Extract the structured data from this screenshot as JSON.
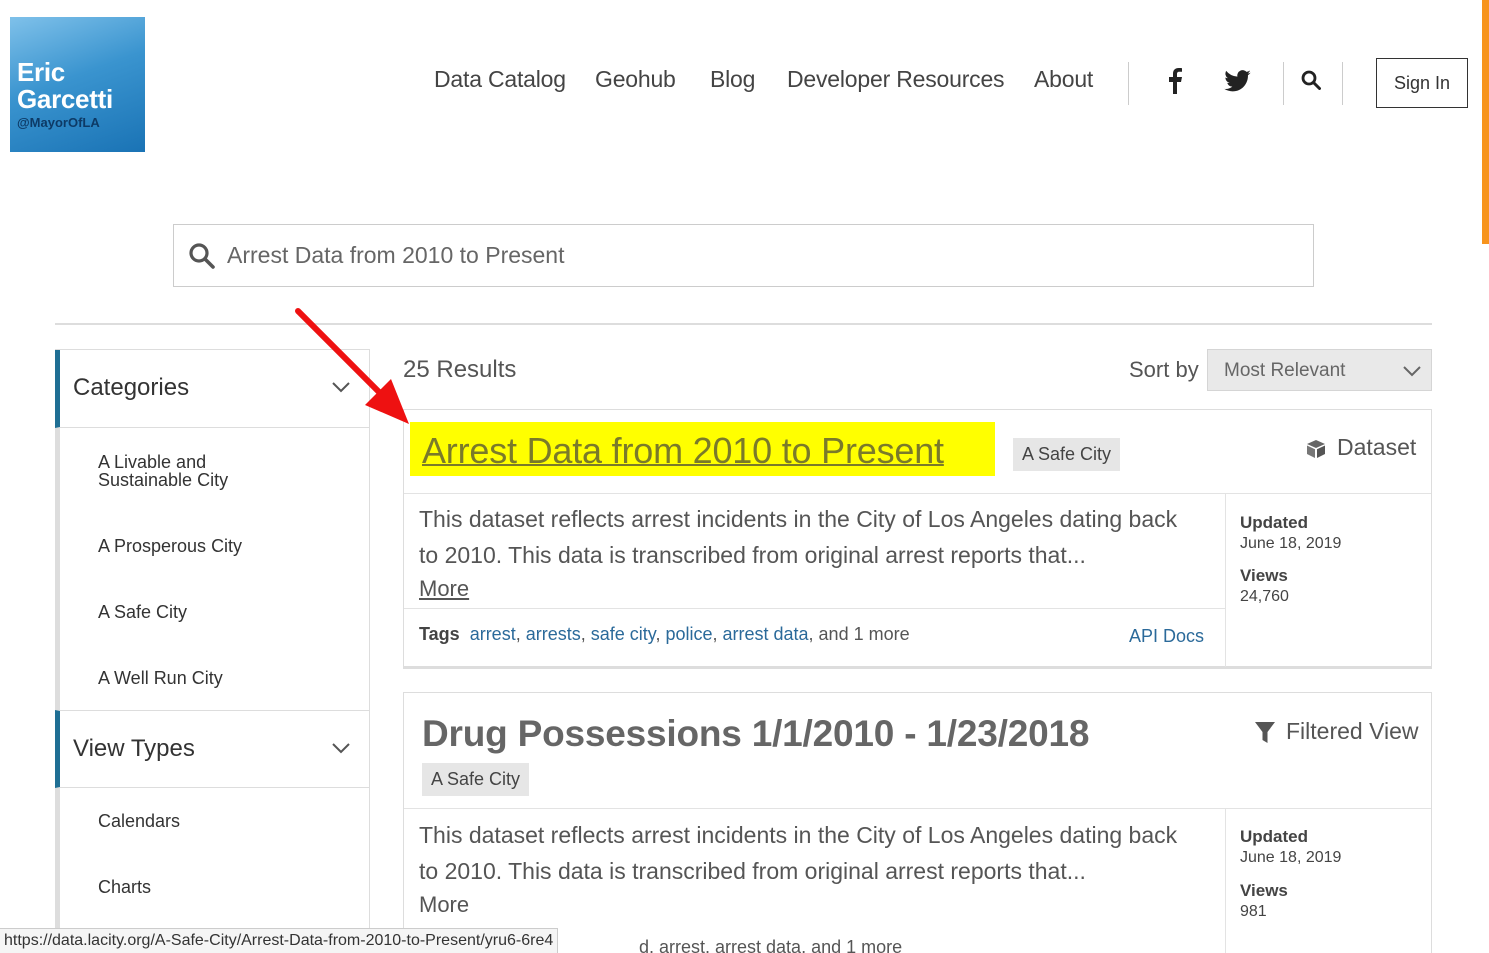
{
  "logo": {
    "line1": "Eric",
    "line2": "Garcetti",
    "handle": "@MayorOfLA"
  },
  "nav": {
    "items": [
      "Data Catalog",
      "Geohub",
      "Blog",
      "Developer Resources",
      "About"
    ],
    "sign_in": "Sign In"
  },
  "search": {
    "value": "Arrest Data from 2010 to Present"
  },
  "sidebar": {
    "categories_title": "Categories",
    "categories": [
      "A Livable and Sustainable City",
      "A Prosperous City",
      "A Safe City",
      "A Well Run City"
    ],
    "view_types_title": "View Types",
    "view_types": [
      "Calendars",
      "Charts"
    ]
  },
  "results": {
    "count": "25 Results",
    "sort_label": "Sort by",
    "sort_value": "Most Relevant",
    "items": [
      {
        "title": "Arrest Data from 2010 to Present",
        "category": "A Safe City",
        "type": "Dataset",
        "desc1": "This dataset reflects arrest incidents in the City of Los Angeles dating back",
        "desc2": "to 2010. This data is transcribed from original arrest reports that...",
        "more": "More",
        "updated_label": "Updated",
        "updated": "June 18, 2019",
        "views_label": "Views",
        "views": "24,760",
        "tags_label": "Tags",
        "tags": [
          "arrest",
          "arrests",
          "safe city",
          "police",
          "arrest data"
        ],
        "tags_more": ", and 1 more",
        "api_docs": "API Docs"
      },
      {
        "title": "Drug Possessions 1/1/2010 - 1/23/2018",
        "category": "A Safe City",
        "type": "Filtered View",
        "desc1": "This dataset reflects arrest incidents in the City of Los Angeles dating back",
        "desc2": "to 2010. This data is transcribed from original arrest reports that...",
        "more": "More",
        "updated_label": "Updated",
        "updated": "June 18, 2019",
        "views_label": "Views",
        "views": "981",
        "tags_partial": "d, arrest, arrest data, and 1 more"
      }
    ]
  },
  "status_url": "https://data.lacity.org/A-Safe-City/Arrest-Data-from-2010-to-Present/yru6-6re4",
  "colors": {
    "highlight": "#ffff00",
    "arrow": "#ee1111",
    "accent": "#1f6f94",
    "link": "#2b6a9a",
    "scroll_accent": "#f7941d"
  }
}
